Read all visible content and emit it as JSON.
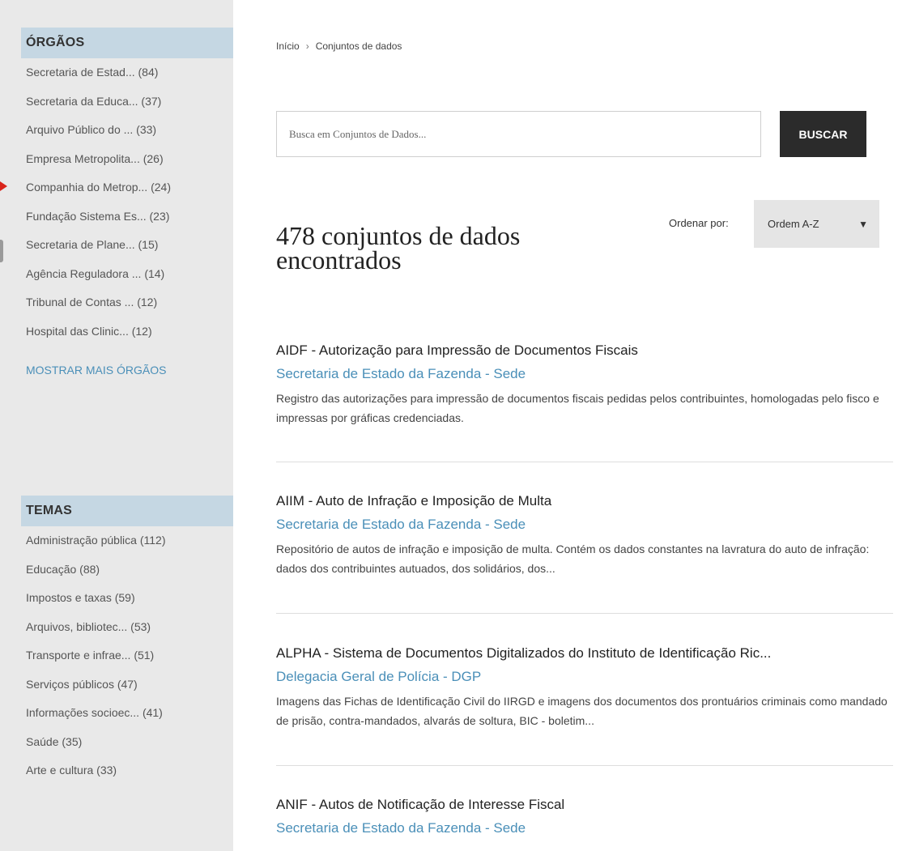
{
  "sidebar": {
    "orgaos": {
      "header": "ÓRGÃOS",
      "items": [
        "Secretaria de Estad... (84)",
        "Secretaria da Educa... (37)",
        "Arquivo Público do ... (33)",
        "Empresa Metropolita... (26)",
        "Companhia do Metrop... (24)",
        "Fundação Sistema Es... (23)",
        "Secretaria de Plane... (15)",
        "Agência Reguladora ... (14)",
        "Tribunal de Contas ... (12)",
        "Hospital das Clinic... (12)"
      ],
      "more": "MOSTRAR MAIS ÓRGÃOS"
    },
    "temas": {
      "header": "TEMAS",
      "items": [
        "Administração pública (112)",
        "Educação (88)",
        "Impostos e taxas (59)",
        "Arquivos, bibliotec... (53)",
        "Transporte e infrae... (51)",
        "Serviços públicos (47)",
        "Informações socioec... (41)",
        "Saúde (35)",
        "Arte e cultura (33)"
      ]
    }
  },
  "breadcrumb": {
    "home": "Início",
    "separator": "›",
    "current": "Conjuntos de dados"
  },
  "search": {
    "placeholder": "Busca em Conjuntos de Dados...",
    "button": "BUSCAR"
  },
  "results": {
    "title": "478 conjuntos de dados encontrados",
    "sort_label": "Ordenar por:",
    "sort_value": "Ordem A-Z",
    "items": [
      {
        "title": "AIDF - Autorização para Impressão de Documentos Fiscais",
        "org": "Secretaria de Estado da Fazenda - Sede",
        "desc": "Registro das autorizações para impressão de documentos fiscais pedidas pelos contribuintes, homologadas pelo fisco e impressas por gráficas credenciadas."
      },
      {
        "title": "AIIM - Auto de Infração e Imposição de Multa",
        "org": "Secretaria de Estado da Fazenda - Sede",
        "desc": "Repositório de autos de infração e imposição de multa. Contém os dados constantes na lavratura do auto de infração: dados dos contribuintes autuados, dos solidários, dos..."
      },
      {
        "title": "ALPHA - Sistema de Documentos Digitalizados do Instituto de Identificação Ric...",
        "org": "Delegacia Geral de Polícia - DGP",
        "desc": "Imagens das Fichas de Identificação Civil do IIRGD e imagens dos documentos dos prontuários criminais como mandado de prisão, contra-mandados, alvarás de soltura, BIC - boletim..."
      },
      {
        "title": "ANIF - Autos de Notificação de Interesse Fiscal",
        "org": "Secretaria de Estado da Fazenda - Sede",
        "desc": ""
      }
    ]
  },
  "colors": {
    "accent_link": "#4a8fb8",
    "facet_header_bg": "#c5d7e3",
    "sidebar_bg": "#e9e9e9",
    "button_bg": "#2b2b2b"
  }
}
